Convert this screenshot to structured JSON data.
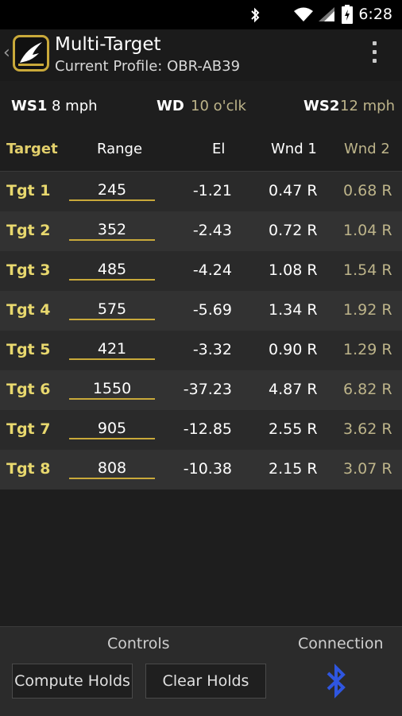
{
  "status": {
    "time": "6:28"
  },
  "header": {
    "title": "Multi-Target",
    "subtitle": "Current Profile: OBR-AB39"
  },
  "wind": {
    "ws1_label": "WS1",
    "ws1_value": "8 mph",
    "wd_label": "WD",
    "wd_value": "10 o'clk",
    "ws2_label": "WS2",
    "ws2_value": "12 mph"
  },
  "table": {
    "columns": [
      "Target",
      "Range",
      "El",
      "Wnd 1",
      "Wnd 2"
    ],
    "rows": [
      {
        "name": "Tgt 1",
        "range": "245",
        "el": "-1.21",
        "w1": "0.47 R",
        "w2": "0.68 R"
      },
      {
        "name": "Tgt 2",
        "range": "352",
        "el": "-2.43",
        "w1": "0.72 R",
        "w2": "1.04 R"
      },
      {
        "name": "Tgt 3",
        "range": "485",
        "el": "-4.24",
        "w1": "1.08 R",
        "w2": "1.54 R"
      },
      {
        "name": "Tgt 4",
        "range": "575",
        "el": "-5.69",
        "w1": "1.34 R",
        "w2": "1.92 R"
      },
      {
        "name": "Tgt 5",
        "range": "421",
        "el": "-3.32",
        "w1": "0.90 R",
        "w2": "1.29 R"
      },
      {
        "name": "Tgt 6",
        "range": "1550",
        "el": "-37.23",
        "w1": "4.87 R",
        "w2": "6.82 R"
      },
      {
        "name": "Tgt 7",
        "range": "905",
        "el": "-12.85",
        "w1": "2.55 R",
        "w2": "3.62 R"
      },
      {
        "name": "Tgt 8",
        "range": "808",
        "el": "-10.38",
        "w1": "2.15 R",
        "w2": "3.07 R"
      }
    ]
  },
  "bottom": {
    "controls_label": "Controls",
    "connection_label": "Connection",
    "compute_label": "Compute Holds",
    "clear_label": "Clear Holds"
  },
  "colors": {
    "accent_gold": "#c9a93a",
    "target_yellow": "#e8d86e",
    "secondary_wind": "#bdb48a",
    "bluetooth_blue": "#2f56e0"
  },
  "icons": [
    "bluetooth-icon",
    "wifi-icon",
    "signal-icon",
    "battery-icon",
    "back-chevron-icon",
    "app-logo-icon",
    "overflow-menu-icon"
  ]
}
